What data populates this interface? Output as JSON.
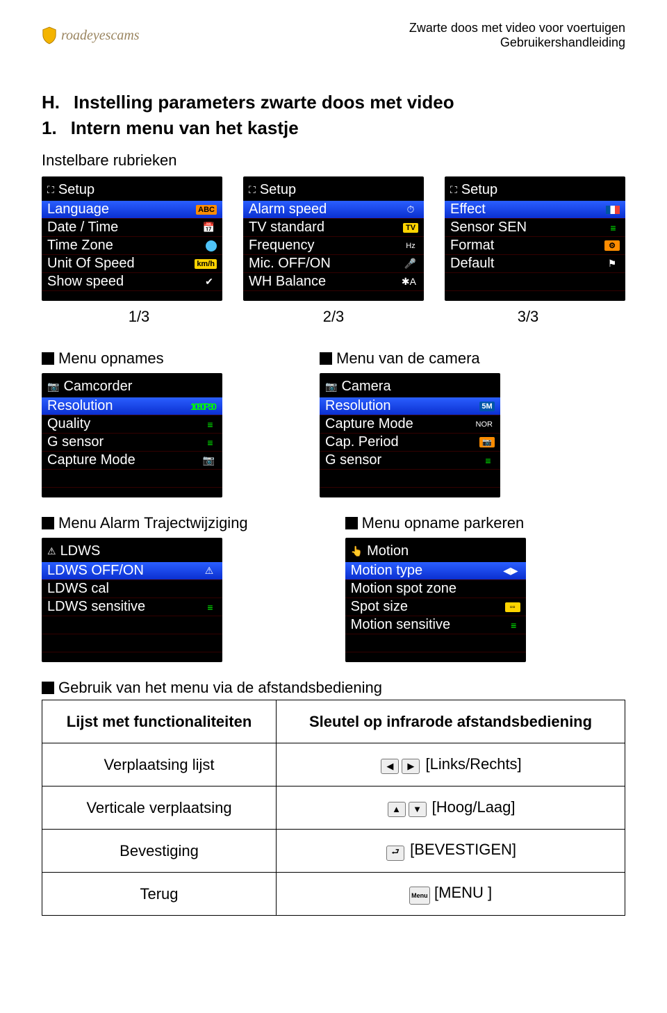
{
  "header": {
    "logo_text": "roadeyescams",
    "line1": "Zwarte doos met video voor voertuigen",
    "line2": "Gebruikershandleiding"
  },
  "section_h": {
    "letter": "H.",
    "title": "Instelling parameters zwarte doos met video"
  },
  "section_1": {
    "num": "1.",
    "title": "Intern menu van het kastje"
  },
  "subhead": "Instelbare rubrieken",
  "setup_screens": [
    {
      "title": "Setup",
      "items": [
        {
          "label": "Language",
          "badge": "ABC",
          "badge_class": "b-orange",
          "selected": true
        },
        {
          "label": "Date / Time",
          "badge": "📅",
          "badge_class": "b-icon"
        },
        {
          "label": "Time Zone",
          "badge": "",
          "badge_class": "globe"
        },
        {
          "label": "Unit Of Speed",
          "badge": "km/h",
          "badge_class": "b-yellow"
        },
        {
          "label": "Show speed",
          "badge": "✔",
          "badge_class": "b-icon"
        }
      ]
    },
    {
      "title": "Setup",
      "items": [
        {
          "label": "Alarm speed",
          "badge": "⏱",
          "badge_class": "b-icon",
          "selected": true
        },
        {
          "label": "TV standard",
          "badge": "TV",
          "badge_class": "b-yellow"
        },
        {
          "label": "Frequency",
          "badge": "Hz",
          "badge_class": ""
        },
        {
          "label": "Mic. OFF/ON",
          "badge": "🎤",
          "badge_class": "mic-ic"
        },
        {
          "label": "WH Balance",
          "badge": "✱A",
          "badge_class": "b-icon"
        }
      ]
    },
    {
      "title": "Setup",
      "items": [
        {
          "label": "Effect",
          "badge": "",
          "badge_class": "b-flag",
          "selected": true
        },
        {
          "label": "Sensor SEN",
          "badge": "≡",
          "badge_class": "b-green3"
        },
        {
          "label": "Format",
          "badge": "⚙",
          "badge_class": "b-orange"
        },
        {
          "label": "Default",
          "badge": "⚑",
          "badge_class": "b-icon"
        },
        {
          "label": "",
          "badge": "",
          "badge_class": ""
        }
      ]
    }
  ],
  "pagers": [
    "1/3",
    "2/3",
    "3/3"
  ],
  "labels_row1": {
    "left": "Menu opnames",
    "right": "Menu van de camera"
  },
  "camcorder_screen": {
    "title": "Camcorder",
    "items": [
      {
        "label": "Resolution",
        "badge": "1080P30",
        "badge_class": "b-green3",
        "selected": true
      },
      {
        "label": "Quality",
        "badge": "≡",
        "badge_class": "b-green3"
      },
      {
        "label": "G sensor",
        "badge": "≡",
        "badge_class": "b-green3"
      },
      {
        "label": "Capture Mode",
        "badge": "📷",
        "badge_class": "cam-ic"
      },
      {
        "label": "",
        "badge": "",
        "badge_class": ""
      }
    ]
  },
  "camera_screen": {
    "title": "Camera",
    "items": [
      {
        "label": "Resolution",
        "badge": "5M",
        "badge_class": "b-blue",
        "selected": true
      },
      {
        "label": "Capture Mode",
        "badge": "NOR",
        "badge_class": ""
      },
      {
        "label": "Cap. Period",
        "badge": "📷",
        "badge_class": "b-orange"
      },
      {
        "label": "G sensor",
        "badge": "≡",
        "badge_class": "b-green3"
      },
      {
        "label": "",
        "badge": "",
        "badge_class": ""
      }
    ]
  },
  "labels_row2": {
    "left": "Menu Alarm Trajectwijziging",
    "right": "Menu opname parkeren"
  },
  "ldws_screen": {
    "title": "LDWS",
    "items": [
      {
        "label": "LDWS OFF/ON",
        "badge": "⚠",
        "badge_class": "b-icon",
        "selected": true
      },
      {
        "label": "LDWS cal",
        "badge": "",
        "badge_class": ""
      },
      {
        "label": "LDWS sensitive",
        "badge": "≡",
        "badge_class": "b-green3"
      },
      {
        "label": "",
        "badge": "",
        "badge_class": ""
      },
      {
        "label": "",
        "badge": "",
        "badge_class": ""
      }
    ]
  },
  "motion_screen": {
    "title": "Motion",
    "items": [
      {
        "label": "Motion type",
        "badge": "◀▶",
        "badge_class": "b-icon",
        "selected": true
      },
      {
        "label": "Motion spot zone",
        "badge": "",
        "badge_class": ""
      },
      {
        "label": "Spot size",
        "badge": "▫▫",
        "badge_class": "b-yellow"
      },
      {
        "label": "Motion sensitive",
        "badge": "≡",
        "badge_class": "b-green3"
      },
      {
        "label": "",
        "badge": "",
        "badge_class": ""
      }
    ]
  },
  "remote": {
    "heading": "Gebruik van het menu via de afstandsbediening",
    "h1": "Lijst met functionaliteiten",
    "h2": "Sleutel op infrarode afstandsbediening",
    "rows": [
      {
        "label": "Verplaatsing lijst",
        "key": "[Links/Rechts]",
        "icons": [
          "◀",
          "▶"
        ]
      },
      {
        "label": "Verticale verplaatsing",
        "key": "[Hoog/Laag]",
        "icons": [
          "▲",
          "▼"
        ]
      },
      {
        "label": "Bevestiging",
        "key": "[BEVESTIGEN]",
        "icons": [
          "⮐"
        ]
      },
      {
        "label": "Terug",
        "key": "[MENU ]",
        "icons": [
          "Menu"
        ]
      }
    ]
  }
}
